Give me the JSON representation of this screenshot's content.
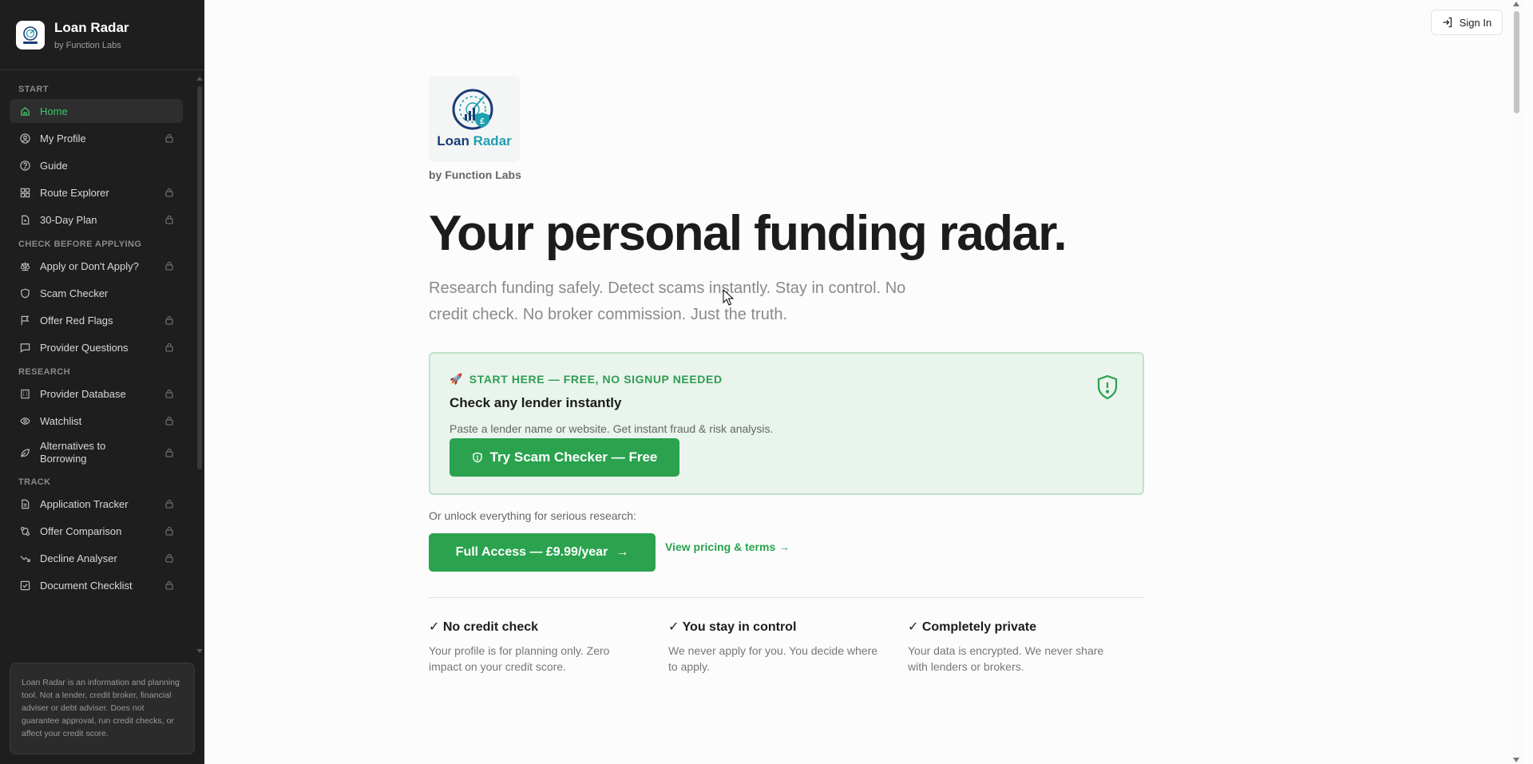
{
  "brand": {
    "title": "Loan Radar",
    "subtitle": "by Function Labs"
  },
  "sidebar": {
    "sections": [
      {
        "label": "START",
        "items": [
          {
            "label": "Home",
            "icon": "home-icon",
            "locked": false,
            "active": true
          },
          {
            "label": "My Profile",
            "icon": "user-circle-icon",
            "locked": true
          },
          {
            "label": "Guide",
            "icon": "help-circle-icon",
            "locked": false
          },
          {
            "label": "Route Explorer",
            "icon": "grid-icon",
            "locked": true
          },
          {
            "label": "30-Day Plan",
            "icon": "file-icon",
            "locked": true
          }
        ]
      },
      {
        "label": "CHECK BEFORE APPLYING",
        "items": [
          {
            "label": "Apply or Don't Apply?",
            "icon": "scale-icon",
            "locked": true
          },
          {
            "label": "Scam Checker",
            "icon": "shield-icon",
            "locked": false
          },
          {
            "label": "Offer Red Flags",
            "icon": "flag-icon",
            "locked": true
          },
          {
            "label": "Provider Questions",
            "icon": "message-icon",
            "locked": true
          }
        ]
      },
      {
        "label": "RESEARCH",
        "items": [
          {
            "label": "Provider Database",
            "icon": "building-icon",
            "locked": true
          },
          {
            "label": "Watchlist",
            "icon": "eye-icon",
            "locked": true
          },
          {
            "label": "Alternatives to Borrowing",
            "icon": "leaf-icon",
            "locked": true
          }
        ]
      },
      {
        "label": "TRACK",
        "items": [
          {
            "label": "Application Tracker",
            "icon": "document-icon",
            "locked": true
          },
          {
            "label": "Offer Comparison",
            "icon": "compare-icon",
            "locked": true
          },
          {
            "label": "Decline Analyser",
            "icon": "trend-down-icon",
            "locked": true
          },
          {
            "label": "Document Checklist",
            "icon": "checklist-icon",
            "locked": true
          }
        ]
      }
    ],
    "disclaimer": "Loan Radar is an information and planning tool. Not a lender, credit broker, financial adviser or debt adviser. Does not guarantee approval, run credit checks, or affect your credit score."
  },
  "header": {
    "signin_label": "Sign In"
  },
  "hero": {
    "logo_word1": "Loan",
    "logo_word2": "Radar",
    "byline": "by Function Labs",
    "title": "Your personal funding radar.",
    "lead": "Research funding safely. Detect scams instantly. Stay in control. No credit check. No broker commission. Just the truth."
  },
  "cta": {
    "eyebrow": "START HERE — FREE, NO SIGNUP NEEDED",
    "title": "Check any lender instantly",
    "description": "Paste a lender name or website. Get instant fraud & risk analysis.",
    "button": "Try Scam Checker — Free"
  },
  "unlock": {
    "text": "Or unlock everything for serious research:",
    "button": "Full Access — £9.99/year",
    "link": "View pricing & terms →"
  },
  "features": [
    {
      "title": "✓ No credit check",
      "desc": "Your profile is for planning only. Zero impact on your credit score."
    },
    {
      "title": "✓ You stay in control",
      "desc": "We never apply for you. You decide where to apply."
    },
    {
      "title": "✓ Completely private",
      "desc": "Your data is encrypted. We never share with lenders or brokers."
    }
  ],
  "colors": {
    "accent": "#2aa24e",
    "sidebar_bg": "#1e1e1e",
    "active_text": "#3ec46d",
    "card_bg": "#e9f4ec"
  }
}
